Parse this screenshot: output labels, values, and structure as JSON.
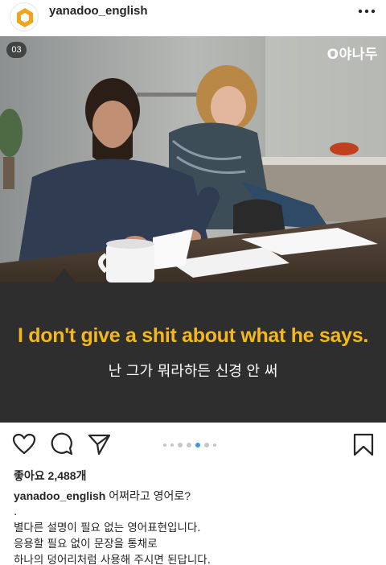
{
  "header": {
    "username": "yanadoo_english",
    "more_icon": "ellipsis-icon"
  },
  "post": {
    "slide_badge": "03",
    "brand_logo": "O야나두",
    "english_sentence": "I don't give a shit about what he says.",
    "korean_sentence": "난 그가 뭐라하든 신경 안 써",
    "colors": {
      "highlight": "#f5b81c",
      "panel": "#2e2e2e",
      "active_dot": "#3897f0"
    }
  },
  "actions": {
    "icons": [
      "heart-icon",
      "comment-icon",
      "share-icon",
      "bookmark-icon"
    ],
    "carousel_total": 7,
    "carousel_active": 4
  },
  "details": {
    "likes": "좋아요 2,488개",
    "caption_user": "yanadoo_english",
    "caption_text": "어쩌라고 영어로?",
    "lines": [
      ".",
      "별다른 설명이 필요 없는 영어표현입니다.",
      "응용할 필요 없이 문장을 통채로",
      "하나의 덩어리처럼 사용해 주시면 된답니다."
    ]
  }
}
